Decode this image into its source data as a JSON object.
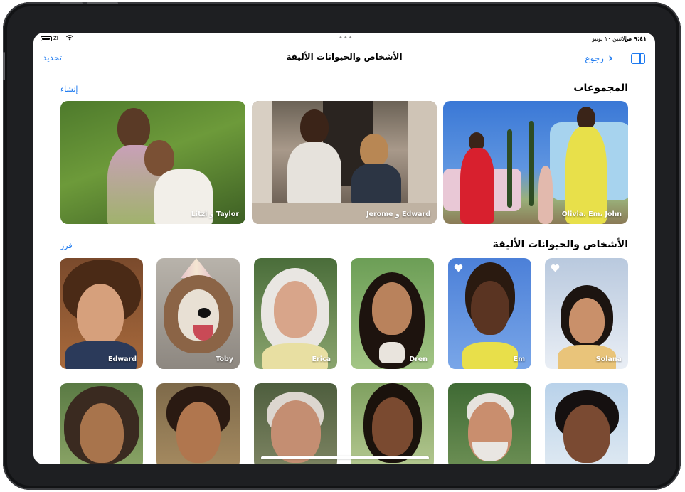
{
  "status_bar": {
    "time": "٩:٤١ ص",
    "date": "الاثنين ١٠ يونيو",
    "signal": "Zl"
  },
  "nav": {
    "title": "الأشخاص والحيوانات الأليفة",
    "select_label": "تحديد",
    "back_label": "رجوع"
  },
  "groups": {
    "title": "المجموعات",
    "action": "إنشاء",
    "items": [
      {
        "label": "Olivia، Em، John"
      },
      {
        "label": "Jerome و Edward"
      },
      {
        "label": "Litzi و Taylor"
      }
    ]
  },
  "people": {
    "title": "الأشخاص والحيوانات الأليفة",
    "action": "فرز",
    "row1": [
      {
        "label": "Solana",
        "favorite": true
      },
      {
        "label": "Em",
        "favorite": true
      },
      {
        "label": "Dren",
        "favorite": false
      },
      {
        "label": "Erica",
        "favorite": false
      },
      {
        "label": "Toby",
        "favorite": false
      },
      {
        "label": "Edward",
        "favorite": false
      }
    ],
    "row2_count_visible": 6
  },
  "colors": {
    "accent": "#1f7bf0",
    "bezel": "#1e1f22"
  }
}
